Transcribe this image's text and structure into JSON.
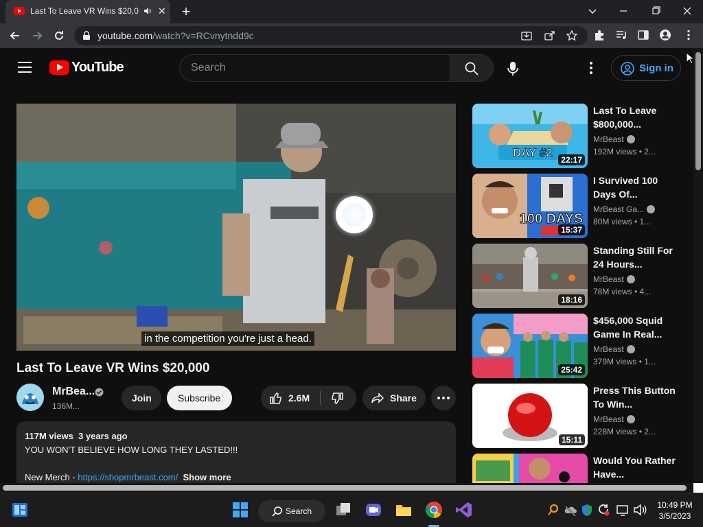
{
  "browser": {
    "tab_title": "Last To Leave VR Wins $20,0",
    "url_host": "youtube.com",
    "url_path": "/watch?v=RCvnytndd9c"
  },
  "youtube": {
    "logo_text": "YouTube",
    "search_placeholder": "Search",
    "signin_label": "Sign in"
  },
  "video": {
    "caption": "in the competition you're just a head.",
    "title": "Last To Leave VR Wins $20,000",
    "channel": "MrBea...",
    "subscribers": "136M...",
    "join_label": "Join",
    "subscribe_label": "Subscribe",
    "likes": "2.6M",
    "share_label": "Share"
  },
  "description": {
    "views": "117M views",
    "age": "3 years ago",
    "line1": "YOU WON'T BELIEVE HOW LONG THEY LASTED!!!",
    "merch_prefix": "New Merch - ",
    "merch_link": "https://shopmrbeast.com/",
    "show_more": "Show more"
  },
  "recommendations": [
    {
      "title": "Last To Leave $800,000...",
      "channel": "MrBeast",
      "views": "192M views • 2...",
      "duration": "22:17",
      "thumb_text": "DAY #2"
    },
    {
      "title": "I Survived 100 Days Of...",
      "channel": "MrBeast Ga...",
      "views": "80M views • 1...",
      "duration": "15:37",
      "thumb_text": "100 DAYS"
    },
    {
      "title": "Standing Still For 24 Hours...",
      "channel": "MrBeast",
      "views": "78M views • 4...",
      "duration": "18:16",
      "thumb_text": ""
    },
    {
      "title": "$456,000 Squid Game In Real...",
      "channel": "MrBeast",
      "views": "379M views • 1...",
      "duration": "25:42",
      "thumb_text": ""
    },
    {
      "title": "Press This Button To Win...",
      "channel": "MrBeast",
      "views": "228M views • 2...",
      "duration": "15:11",
      "thumb_text": ""
    },
    {
      "title": "Would You Rather Have...",
      "channel": "",
      "views": "",
      "duration": "",
      "thumb_text": ""
    }
  ],
  "taskbar": {
    "search_label": "Search",
    "time": "10:49 PM",
    "date": "3/5/2023"
  },
  "colors": {
    "background": "#0f0f0f",
    "youtube_red": "#ff0000",
    "link_blue": "#3ea6ff"
  }
}
